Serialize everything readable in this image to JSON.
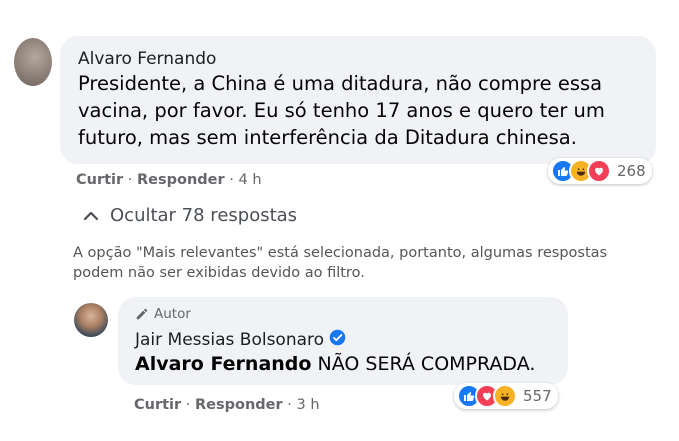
{
  "comment1": {
    "author": "Alvaro Fernando",
    "text_line1": "Presidente, a China é uma ditadura, não compre essa",
    "text_line2": "vacina, por favor. Eu só tenho 17 anos e quero ter um",
    "text_line3": "futuro, mas sem interferência da Ditadura chinesa.",
    "like_label": "Curtir",
    "reply_label": "Responder",
    "time": "4 h",
    "reaction_count": "268",
    "reactions": [
      "like-icon",
      "haha-icon",
      "love-icon"
    ]
  },
  "replies_toggle": {
    "label": "Ocultar 78 respostas",
    "icon": "chevron-up-icon"
  },
  "filter_notice": {
    "line1": "A opção \"Mais relevantes\" está selecionada, portanto, algumas respostas",
    "line2": "podem não ser exibidas devido ao filtro."
  },
  "reply": {
    "badge": "Autor",
    "badge_icon": "pencil-icon",
    "author": "Jair Messias Bolsonaro",
    "verified_icon": "verified-badge-icon",
    "mention": "Alvaro Fernando",
    "text": "NÃO SERÁ COMPRADA.",
    "like_label": "Curtir",
    "reply_label": "Responder",
    "time": "3 h",
    "reaction_count": "557",
    "reactions": [
      "like-icon",
      "love-icon",
      "haha-icon"
    ]
  },
  "colors": {
    "bubble": "#f0f2f5",
    "like": "#1877f2",
    "love": "#f33e58",
    "haha": "#f7b125",
    "verified": "#1877f2"
  }
}
